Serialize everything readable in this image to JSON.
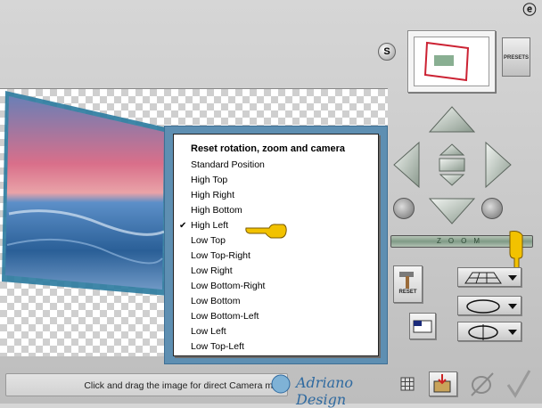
{
  "toolbar": {
    "s_label": "S",
    "presets_label": "PRESETS",
    "reset_label": "RESET",
    "zoom_label": "ZOOM"
  },
  "context_menu": {
    "items": [
      {
        "label": "Reset rotation, zoom and camera",
        "bold": true,
        "checked": false
      },
      {
        "label": "Standard Position",
        "checked": false
      },
      {
        "label": "High Top",
        "checked": false
      },
      {
        "label": "High Right",
        "checked": false
      },
      {
        "label": "High Bottom",
        "checked": false
      },
      {
        "label": "High Left",
        "checked": true
      },
      {
        "label": "Low Top",
        "checked": false
      },
      {
        "label": "Low Top-Right",
        "checked": false
      },
      {
        "label": "Low Right",
        "checked": false
      },
      {
        "label": "Low Bottom-Right",
        "checked": false
      },
      {
        "label": "Low Bottom",
        "checked": false
      },
      {
        "label": "Low Bottom-Left",
        "checked": false
      },
      {
        "label": "Low Left",
        "checked": false
      },
      {
        "label": "Low Top-Left",
        "checked": false
      }
    ],
    "check_glyph": "✔"
  },
  "status_bar": {
    "text": "Click and drag the image for direct Camera mo"
  },
  "watermark": {
    "text": "Adriano Design"
  },
  "icons": {
    "top_right": "e-icon",
    "pointer": "pointing-hand-icon",
    "ok": "checkmark-icon",
    "cancel": "cancel-icon"
  },
  "colors": {
    "menu_frame": "#5e8fb2",
    "photo_border": "#2a7a9e",
    "hand": "#f2c200"
  }
}
